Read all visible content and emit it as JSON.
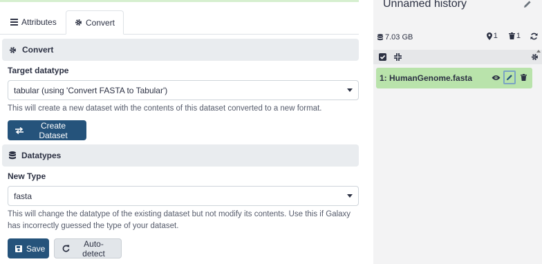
{
  "tabs": [
    {
      "label": "Attributes",
      "icon": "bars-icon"
    },
    {
      "label": "Convert",
      "icon": "gear-icon"
    }
  ],
  "convert": {
    "header": "Convert",
    "target_label": "Target datatype",
    "target_value": "tabular (using 'Convert FASTA to Tabular')",
    "help": "This will create a new dataset with the contents of this dataset converted to a new format.",
    "button": "Create Dataset"
  },
  "datatypes": {
    "header": "Datatypes",
    "new_type_label": "New Type",
    "new_type_value": "fasta",
    "help_line1": "This will change the datatype of the existing dataset but not modify its contents. Use this if Galaxy",
    "help_line2": "has incorrectly guessed the type of your dataset.",
    "save_button": "Save",
    "autodetect_button": "Auto-detect"
  },
  "history": {
    "title": "Unnamed history",
    "size": "7.03 GB",
    "shown_count": "1",
    "deleted_count": "1",
    "dataset_label": "1: HumanGenome.fasta"
  },
  "colors": {
    "primary": "#25537b",
    "dataset_ok": "#b9e3ab",
    "header_bg": "#e9ecef"
  }
}
